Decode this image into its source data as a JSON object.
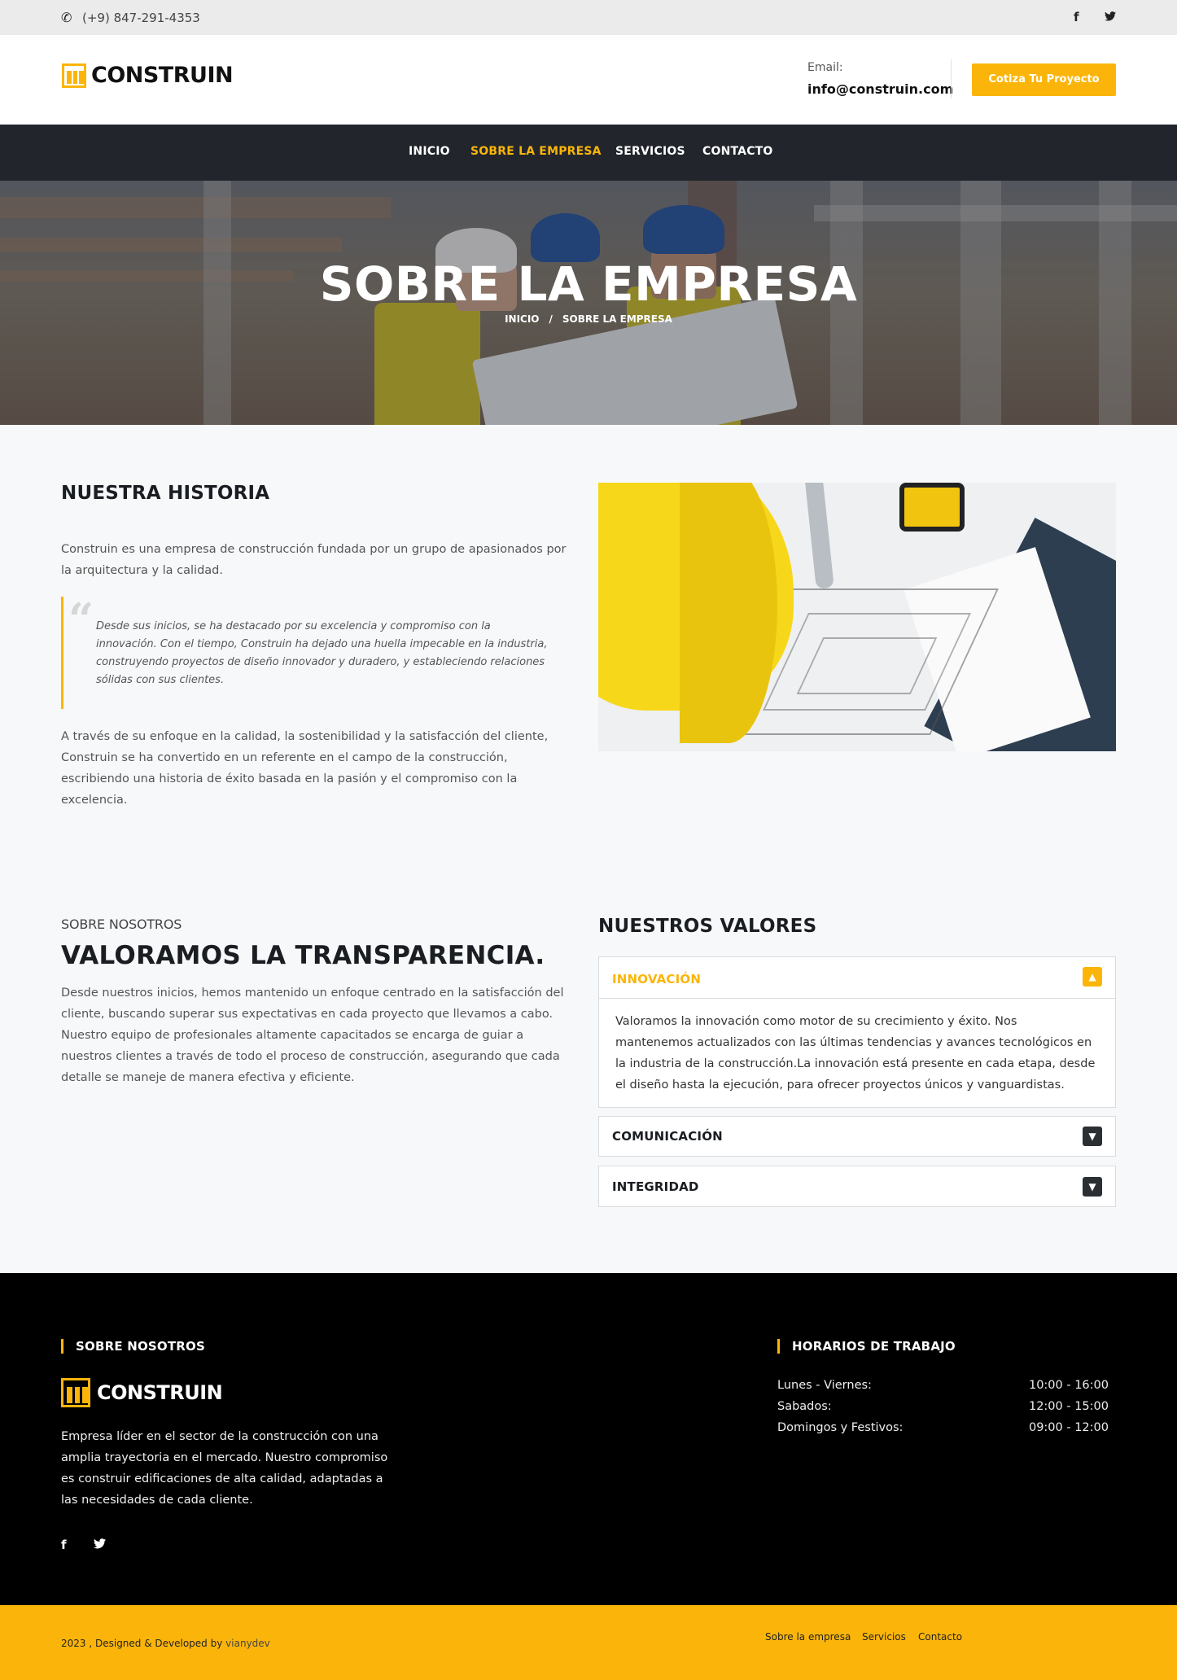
{
  "topbar": {
    "phone": "(+9) 847-291-4353",
    "social": [
      "facebook-icon",
      "twitter-icon"
    ]
  },
  "header": {
    "brand": "CONSTRUIN",
    "email_label": "Email:",
    "email": "info@construin.com",
    "cta_label": "Cotiza Tu Proyecto"
  },
  "nav": {
    "items": [
      {
        "label": "INICIO",
        "active": false
      },
      {
        "label": "SOBRE LA EMPRESA",
        "active": true
      },
      {
        "label": "SERVICIOS",
        "active": false
      },
      {
        "label": "CONTACTO",
        "active": false
      }
    ]
  },
  "hero": {
    "title": "SOBRE LA EMPRESA",
    "breadcrumb": [
      "INICIO",
      "/",
      "SOBRE LA EMPRESA"
    ]
  },
  "historia": {
    "title": "NUESTRA HISTORIA",
    "intro": "Construin es una empresa de construcción fundada por un grupo de apasionados por la arquitectura y la calidad.",
    "quote": "Desde sus inicios, se ha destacado por su excelencia y compromiso con la innovación. Con el tiempo, Construin ha dejado una huella impecable en la industria, construyendo proyectos de diseño innovador y duradero, y estableciendo relaciones sólidas con sus clientes.",
    "closing": "A través de su enfoque en la calidad, la sostenibilidad y la satisfacción del cliente, Construin se ha convertido en un referente en el campo de la construcción, escribiendo una historia de éxito basada en la pasión y el compromiso con la excelencia."
  },
  "sobre": {
    "kicker": "SOBRE NOSOTROS",
    "title": "VALORAMOS LA TRANSPARENCIA.",
    "body": "Desde nuestros inicios, hemos mantenido un enfoque centrado en la satisfacción del cliente, buscando superar sus expectativas en cada proyecto que llevamos a cabo. Nuestro equipo de profesionales altamente capacitados se encarga de guiar a nuestros clientes a través de todo el proceso de construcción, asegurando que cada detalle se maneje de manera efectiva y eficiente."
  },
  "valores": {
    "title": "NUESTROS VALORES",
    "items": [
      {
        "label": "INNOVACIÓN",
        "open": true,
        "body": "Valoramos la innovación como motor de su crecimiento y éxito. Nos mantenemos actualizados con las últimas tendencias y avances tecnológicos en la industria de la construcción.La innovación está presente en cada etapa, desde el diseño hasta la ejecución, para ofrecer proyectos únicos y vanguardistas."
      },
      {
        "label": "COMUNICACIÓN",
        "open": false
      },
      {
        "label": "INTEGRIDAD",
        "open": false
      }
    ]
  },
  "footer": {
    "about_title": "SOBRE NOSOTROS",
    "brand": "CONSTRUIN",
    "description": "Empresa líder en el sector de la construcción con una amplia trayectoria en el mercado. Nuestro compromiso es construir edificaciones de alta calidad, adaptadas a las necesidades de cada cliente.",
    "hours_title": "HORARIOS DE TRABAJO",
    "hours": [
      {
        "day": "Lunes - Viernes:",
        "time": "10:00 - 16:00"
      },
      {
        "day": "Sabados:",
        "time": "12:00 - 15:00"
      },
      {
        "day": "Domingos y Festivos:",
        "time": "09:00 - 12:00"
      }
    ],
    "copyright": "2023 , Designed & Developed by",
    "developer": "vianydev",
    "links": [
      "Sobre la empresa",
      "Servicios",
      "Contacto"
    ]
  },
  "colors": {
    "accent": "#fbb50a",
    "nav_bg": "#22262c",
    "footer_bg": "#000000"
  }
}
